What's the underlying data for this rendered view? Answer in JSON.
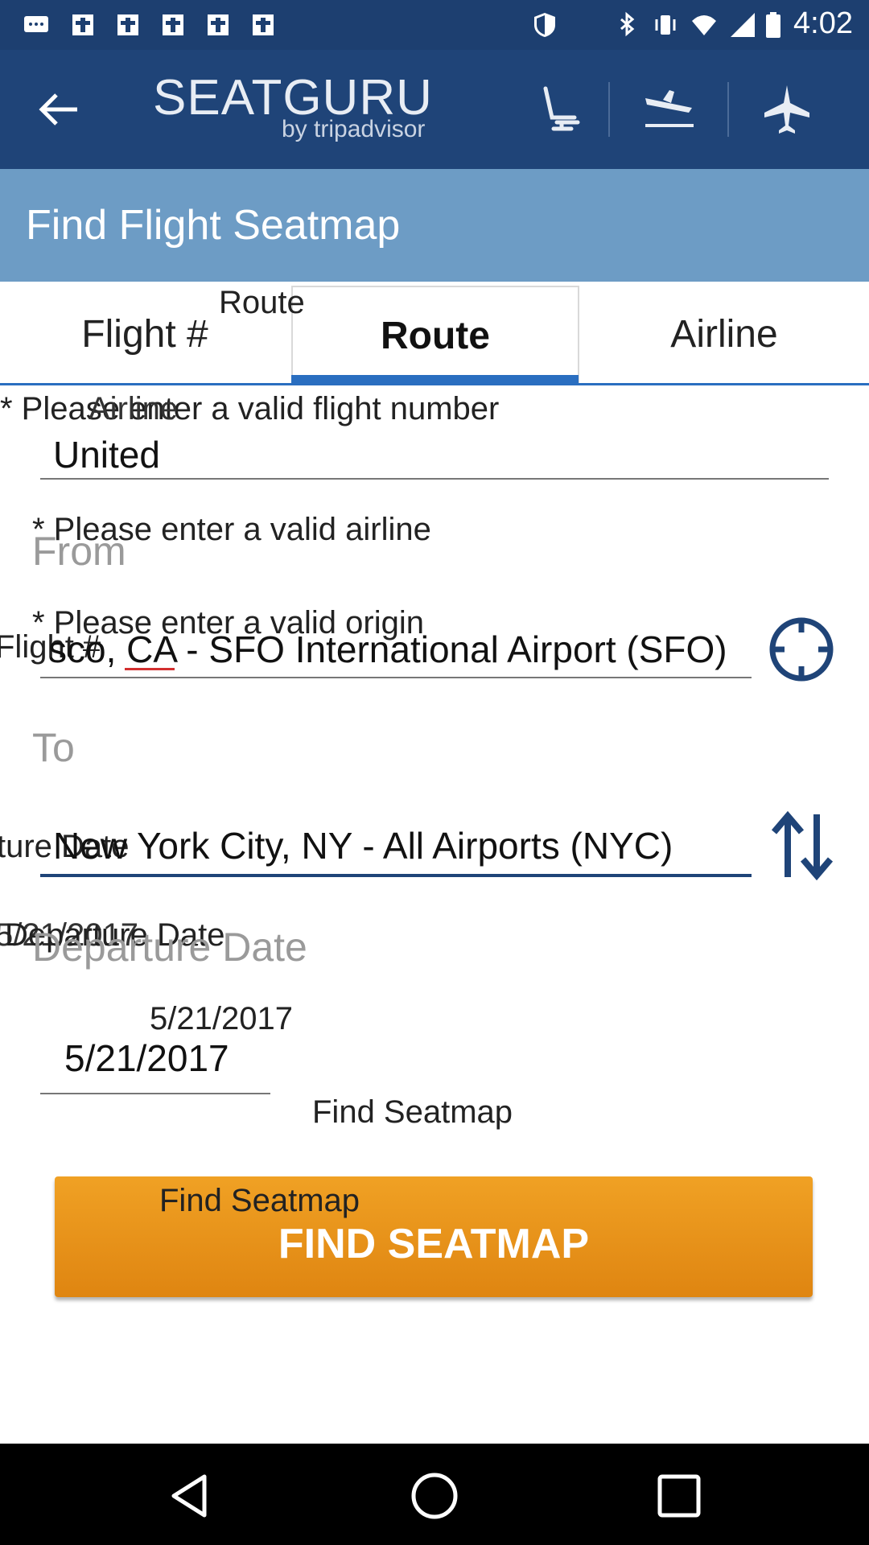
{
  "status_bar": {
    "time": "4:02",
    "icons": [
      "chat-icon",
      "notification-icon",
      "notification-icon",
      "notification-icon",
      "notification-icon",
      "shield-icon",
      "bluetooth-icon",
      "vibrate-icon",
      "wifi-icon",
      "signal-icon",
      "battery-icon"
    ]
  },
  "header": {
    "logo_main": "SEATGURU",
    "logo_sub": "by tripadvisor",
    "icons": [
      "back-arrow-icon",
      "seat-icon",
      "arrival-plane-icon",
      "plane-icon"
    ]
  },
  "page": {
    "title": "Find Flight Seatmap"
  },
  "tabs": [
    {
      "label": "Flight #"
    },
    {
      "label": "Route",
      "selected": true
    },
    {
      "label": "Airline"
    }
  ],
  "overlay": {
    "route_hint": "Route",
    "airline_hint": "Airline",
    "flight_hint": "Flight #",
    "departure_overlap": "ture Date",
    "date_overlap": "5/21/2017",
    "departure_date_hint": "Departure Date",
    "date_value_hint": "5/21/2017",
    "find_hint": "Find Seatmap",
    "button_hint": "Find Seatmap"
  },
  "form": {
    "flight_number_error": "* Please enter a valid flight number",
    "airline_value": "United",
    "airline_error": "* Please enter a valid airline",
    "from_label": "From",
    "origin_error": "* Please enter a valid origin",
    "origin_value": "sco, CA - SFO International Airport (SFO)",
    "to_label": "To",
    "destination_value": "New York City, NY - All Airports (NYC)",
    "departure_label": "Departure Date",
    "date_value": "5/21/2017"
  },
  "button": {
    "label": "FIND SEATMAP"
  },
  "colors": {
    "status_bar": "#1d3f70",
    "app_bar": "#1f4478",
    "title_band": "#6d9cc5",
    "accent": "#2a6ec0",
    "button": "#e8921a",
    "icon_blue": "#1f4478"
  }
}
